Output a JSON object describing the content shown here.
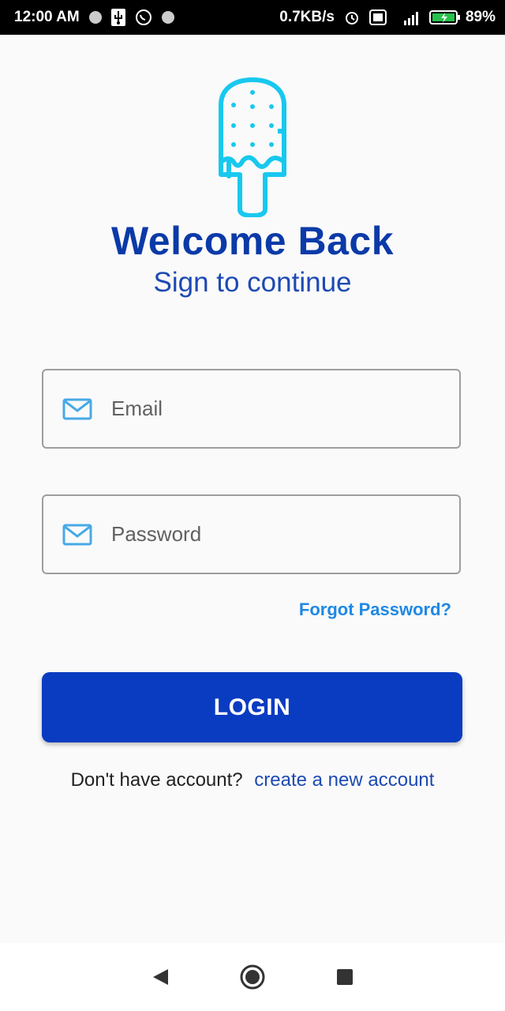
{
  "status_bar": {
    "time": "12:00 AM",
    "speed": "0.7KB/s",
    "battery": "89%"
  },
  "login": {
    "title": "Welcome Back",
    "subtitle": "Sign to continue",
    "email_placeholder": "Email",
    "password_placeholder": "Password",
    "forgot_label": "Forgot Password?",
    "login_label": "LOGIN",
    "no_account_text": "Don't have account?",
    "create_account_label": "create a new account"
  },
  "colors": {
    "primary": "#0a3cc1",
    "accent": "#1e88e5",
    "logo": "#18c8ef"
  },
  "icons": {
    "logo": "popsicle-icon",
    "email": "mail-icon",
    "password": "mail-icon",
    "nav_back": "back-triangle-icon",
    "nav_home": "home-circle-icon",
    "nav_recents": "recents-square-icon"
  }
}
